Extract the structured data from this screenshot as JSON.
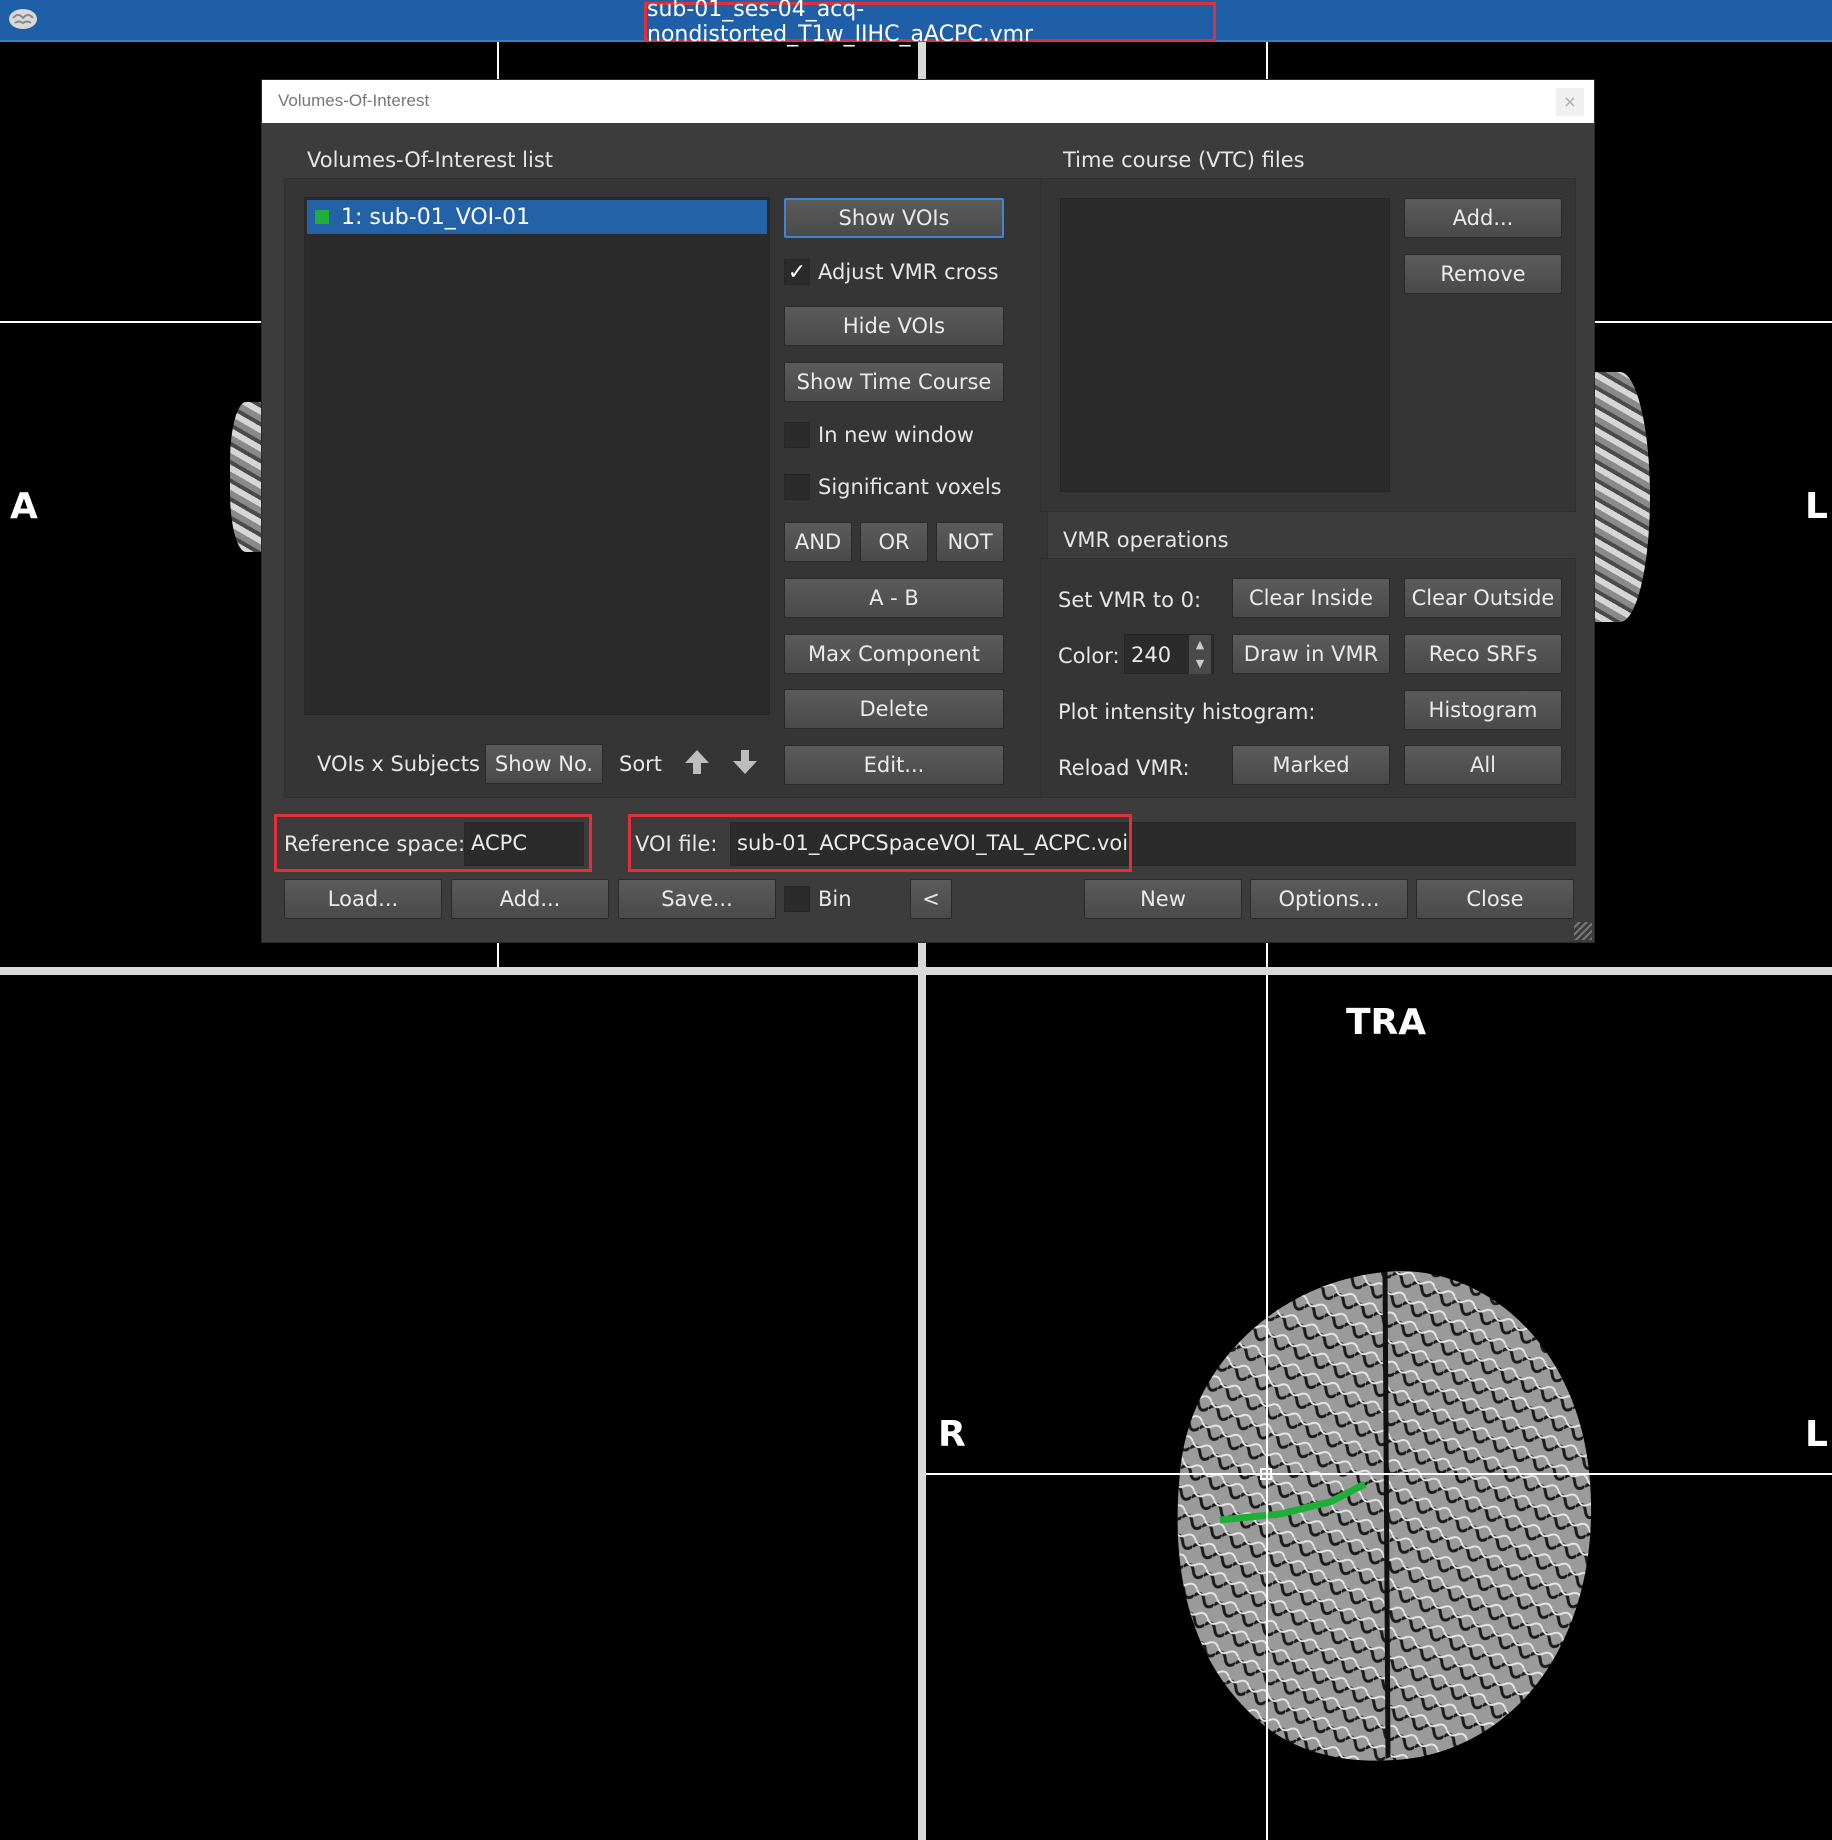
{
  "window": {
    "title": "sub-01_ses-04_acq-nondistorted_T1w_IIHC_aACPC.vmr"
  },
  "views": {
    "top_left_labels": {
      "left": "A",
      "right": "L"
    },
    "bottom_right_labels": {
      "plane": "TRA",
      "left": "R",
      "right": "L"
    }
  },
  "dialog": {
    "title": "Volumes-Of-Interest",
    "close_glyph": "×",
    "voi_list": {
      "header": "Volumes-Of-Interest list",
      "items": [
        {
          "label": "1: sub-01_VOI-01",
          "color": "#1fae3a"
        }
      ],
      "vois_x_subjects": "VOIs x Subjects",
      "show_no": "Show No.",
      "sort": "Sort"
    },
    "middle_buttons": {
      "show_vois": "Show VOIs",
      "adjust_vmr_cross": "Adjust VMR cross",
      "adjust_checked_glyph": "✓",
      "hide_vois": "Hide VOIs",
      "show_time_course": "Show Time Course",
      "in_new_window": "In new window",
      "significant_voxels": "Significant voxels",
      "and": "AND",
      "or": "OR",
      "not": "NOT",
      "a_minus_b": "A - B",
      "max_component": "Max Component",
      "delete": "Delete",
      "edit": "Edit..."
    },
    "vtc": {
      "header": "Time course (VTC) files",
      "add": "Add...",
      "remove": "Remove"
    },
    "vmr_ops": {
      "header": "VMR operations",
      "set_vmr_label": "Set VMR to 0:",
      "clear_inside": "Clear Inside",
      "clear_outside": "Clear Outside",
      "color_label": "Color:",
      "color_value": "240",
      "draw_in_vmr": "Draw in VMR",
      "reco_srfs": "Reco SRFs",
      "plot_hist_label": "Plot intensity histogram:",
      "histogram": "Histogram",
      "reload_label": "Reload VMR:",
      "marked": "Marked",
      "all": "All"
    },
    "footer": {
      "reference_space_label": "Reference space:",
      "reference_space_value": "ACPC",
      "voi_file_label": "VOI file:",
      "voi_file_value": "sub-01_ACPCSpaceVOI_TAL_ACPC.voi",
      "load": "Load...",
      "add": "Add...",
      "save": "Save...",
      "bin": "Bin",
      "back": "<",
      "new": "New",
      "options": "Options...",
      "close": "Close"
    }
  }
}
